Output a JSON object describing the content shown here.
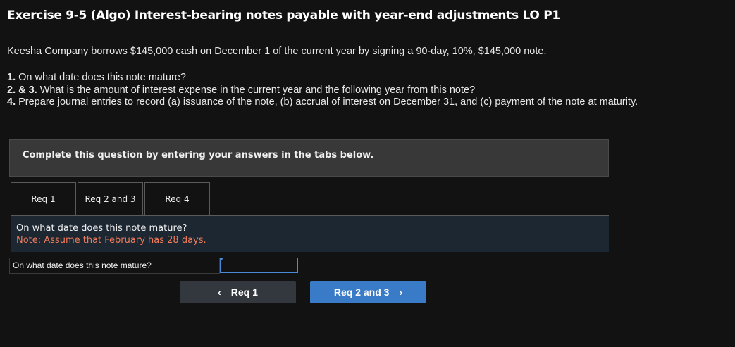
{
  "header": {
    "title": "Exercise 9-5 (Algo) Interest-bearing notes payable with year-end adjustments LO P1"
  },
  "intro": "Keesha Company borrows $145,000 cash on December 1 of the current year by signing a 90-day, 10%, $145,000 note.",
  "questions": [
    {
      "num": "1.",
      "text": " On what date does this note mature?"
    },
    {
      "num": "2. & 3.",
      "text": " What is the amount of interest expense in the current year and the following year from this note?"
    },
    {
      "num": "4.",
      "text": " Prepare journal entries to record (a) issuance of the note, (b) accrual of interest on December 31, and (c) payment of the note at maturity."
    }
  ],
  "instructions": "Complete this question by entering your answers in the tabs below.",
  "tabs": [
    {
      "label": "Req 1",
      "active": true
    },
    {
      "label": "Req 2 and 3",
      "active": false
    },
    {
      "label": "Req 4",
      "active": false
    }
  ],
  "panel": {
    "question": "On what date does this note mature?",
    "note": "Note: Assume that February has 28 days."
  },
  "answer": {
    "label": "On what date does this note mature?",
    "value": ""
  },
  "nav": {
    "prev_label": "Req 1",
    "next_label": "Req 2 and 3",
    "prev_icon": "chevron-left-icon",
    "next_icon": "chevron-right-icon"
  },
  "colors": {
    "background": "#121212",
    "note": "#f07b5a",
    "accent": "#3a7bc8"
  }
}
